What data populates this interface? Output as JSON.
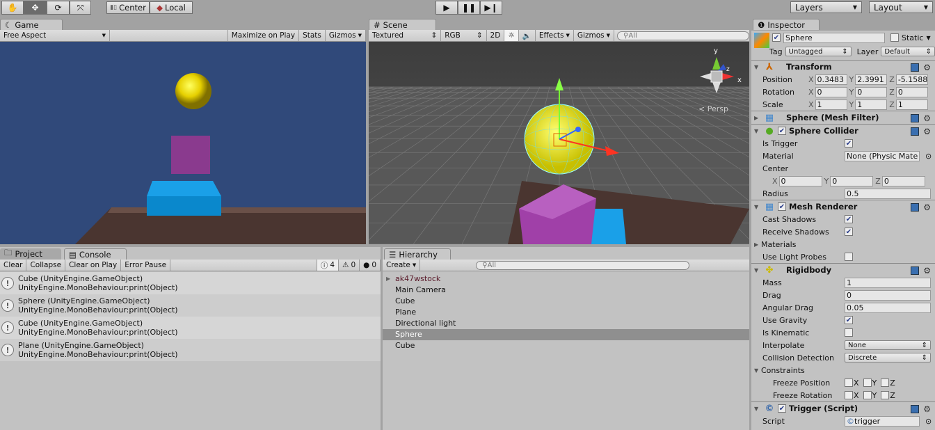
{
  "toolbar": {
    "tools": [
      "hand-tool",
      "move-tool",
      "rotate-tool",
      "scale-tool"
    ],
    "pivot": "Center",
    "space": "Local",
    "play": "play",
    "pause": "pause",
    "step": "step",
    "layers": "Layers",
    "layout": "Layout"
  },
  "game": {
    "tab": "Game",
    "aspect": "Free Aspect",
    "maximize": "Maximize on Play",
    "stats": "Stats",
    "gizmos": "Gizmos",
    "background": "#30497a"
  },
  "scene": {
    "tab": "Scene",
    "render_mode": "Textured",
    "channel": "RGB",
    "mode2d": "2D",
    "effects": "Effects",
    "gizmos": "Gizmos",
    "search": "All",
    "persp": "< Persp",
    "axis_x": "x",
    "axis_y": "y",
    "axis_z": "z"
  },
  "console": {
    "tab_project": "Project",
    "tab": "Console",
    "clear": "Clear",
    "collapse": "Collapse",
    "clear_on_play": "Clear on Play",
    "error_pause": "Error Pause",
    "log_count": "4",
    "warning_count": "0",
    "error_count": "0",
    "entries": [
      [
        "Cube (UnityEngine.GameObject)",
        "UnityEngine.MonoBehaviour:print(Object)"
      ],
      [
        "Sphere (UnityEngine.GameObject)",
        "UnityEngine.MonoBehaviour:print(Object)"
      ],
      [
        "Cube (UnityEngine.GameObject)",
        "UnityEngine.MonoBehaviour:print(Object)"
      ],
      [
        "Plane (UnityEngine.GameObject)",
        "UnityEngine.MonoBehaviour:print(Object)"
      ]
    ]
  },
  "hierarchy": {
    "tab": "Hierarchy",
    "create": "Create",
    "search": "All",
    "items": [
      {
        "label": "ak47wstock",
        "prefab": true,
        "expandable": true
      },
      {
        "label": "Main Camera"
      },
      {
        "label": "Cube"
      },
      {
        "label": "Plane"
      },
      {
        "label": "Directional light"
      },
      {
        "label": "Sphere",
        "selected": true
      },
      {
        "label": "Cube"
      }
    ]
  },
  "inspector": {
    "tab": "Inspector",
    "name": "Sphere",
    "active": true,
    "static_label": "Static",
    "static": false,
    "tag_label": "Tag",
    "tag": "Untagged",
    "layer_label": "Layer",
    "layer": "Default",
    "components": [
      {
        "title": "Transform",
        "icon": "transform-icon",
        "expanded": true,
        "rows": [
          {
            "type": "vec3",
            "label": "Position",
            "values": [
              "0.3483",
              "2.3991",
              "-5.1588"
            ]
          },
          {
            "type": "vec3",
            "label": "Rotation",
            "values": [
              "0",
              "0",
              "0"
            ]
          },
          {
            "type": "vec3",
            "label": "Scale",
            "values": [
              "1",
              "1",
              "1"
            ]
          }
        ]
      },
      {
        "title": "Sphere (Mesh Filter)",
        "icon": "mesh-filter-icon",
        "expanded": false,
        "rows": []
      },
      {
        "title": "Sphere Collider",
        "icon": "sphere-collider-icon",
        "expanded": true,
        "enabled": true,
        "rows": [
          {
            "type": "check",
            "label": "Is Trigger",
            "value": true
          },
          {
            "type": "object",
            "label": "Material",
            "value": "None (Physic Mate"
          },
          {
            "type": "label",
            "label": "Center"
          },
          {
            "type": "vec3i",
            "values": [
              "0",
              "0",
              "0"
            ]
          },
          {
            "type": "text",
            "label": "Radius",
            "value": "0.5"
          }
        ]
      },
      {
        "title": "Mesh Renderer",
        "icon": "mesh-renderer-icon",
        "expanded": true,
        "enabled": true,
        "rows": [
          {
            "type": "check",
            "label": "Cast Shadows",
            "value": true
          },
          {
            "type": "check",
            "label": "Receive Shadows",
            "value": true
          },
          {
            "type": "fold",
            "label": "Materials"
          },
          {
            "type": "check",
            "label": "Use Light Probes",
            "value": false
          }
        ]
      },
      {
        "title": "Rigidbody",
        "icon": "rigidbody-icon",
        "expanded": true,
        "rows": [
          {
            "type": "text",
            "label": "Mass",
            "value": "1"
          },
          {
            "type": "text",
            "label": "Drag",
            "value": "0"
          },
          {
            "type": "text",
            "label": "Angular Drag",
            "value": "0.05"
          },
          {
            "type": "check",
            "label": "Use Gravity",
            "value": true
          },
          {
            "type": "check",
            "label": "Is Kinematic",
            "value": false
          },
          {
            "type": "select",
            "label": "Interpolate",
            "value": "None"
          },
          {
            "type": "select",
            "label": "Collision Detection",
            "value": "Discrete"
          },
          {
            "type": "foldopen",
            "label": "Constraints"
          },
          {
            "type": "xyzcheck",
            "label": "Freeze Position",
            "values": [
              false,
              false,
              false
            ]
          },
          {
            "type": "xyzcheck",
            "label": "Freeze Rotation",
            "values": [
              false,
              false,
              false
            ]
          }
        ]
      },
      {
        "title": "Trigger (Script)",
        "icon": "script-icon",
        "expanded": true,
        "enabled": true,
        "rows": [
          {
            "type": "object",
            "label": "Script",
            "value": "trigger"
          }
        ]
      }
    ]
  }
}
